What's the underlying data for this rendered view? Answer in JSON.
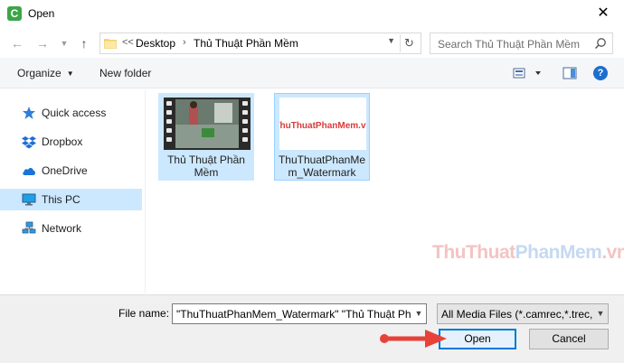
{
  "window": {
    "title": "Open",
    "app_icon_letter": "C"
  },
  "address": {
    "overflow": "<<",
    "crumbs": [
      "Desktop",
      "Thủ Thuật Phần Mềm"
    ]
  },
  "search": {
    "placeholder": "Search Thủ Thuật Phần Mềm"
  },
  "toolbar": {
    "organize": "Organize",
    "new_folder": "New folder"
  },
  "sidebar": {
    "items": [
      {
        "label": "Quick access",
        "icon": "star-icon"
      },
      {
        "label": "Dropbox",
        "icon": "dropbox-icon"
      },
      {
        "label": "OneDrive",
        "icon": "cloud-icon"
      },
      {
        "label": "This PC",
        "icon": "computer-icon",
        "selected": true
      },
      {
        "label": "Network",
        "icon": "network-icon"
      }
    ]
  },
  "files": [
    {
      "name": "Thủ Thuật Phần Mềm",
      "type": "video",
      "selected": true
    },
    {
      "name": "ThuThuatPhanMem_Watermark",
      "type": "image",
      "thumb_text": "ThuThuatPhanMem.vn",
      "selected": true
    }
  ],
  "watermark": {
    "part1": "ThuThuat",
    "part2": "PhanMem",
    "part3": ".vn"
  },
  "bottom": {
    "file_name_label": "File name:",
    "file_name_value": "\"ThuThuatPhanMem_Watermark\" \"Thủ Thuật Phần Mềm\"",
    "filter_value": "All Media Files (*.camrec,*.trec,",
    "open_button": "Open",
    "cancel_button": "Cancel"
  },
  "colors": {
    "accent": "#0078d7",
    "selection": "#cce8ff",
    "arrow": "#e8413a"
  }
}
